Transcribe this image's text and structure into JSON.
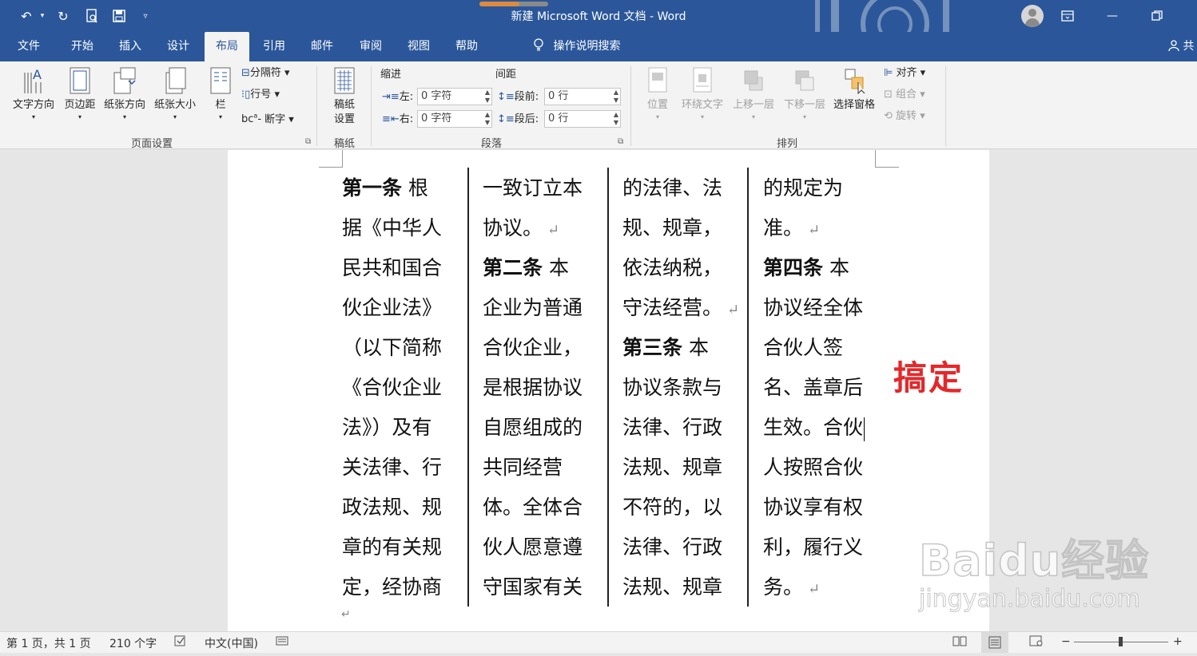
{
  "titlebar": {
    "doc_title": "新建 Microsoft Word 文档  -  Word",
    "undo_icon": "undo-icon",
    "redo_icon": "redo-icon"
  },
  "tabs": [
    "文件",
    "开始",
    "插入",
    "设计",
    "布局",
    "引用",
    "邮件",
    "审阅",
    "视图",
    "帮助"
  ],
  "active_tab": "布局",
  "tell_me": "操作说明搜索",
  "share": "共",
  "ribbon": {
    "page_setup": {
      "text_direction": "文字方向",
      "margins": "页边距",
      "orientation": "纸张方向",
      "size": "纸张大小",
      "columns": "栏",
      "breaks": "分隔符",
      "line_numbers": "行号",
      "hyphenation": "断字",
      "group_label": "页面设置"
    },
    "manuscript": {
      "button_line1": "稿纸",
      "button_line2": "设置",
      "group_label": "稿纸"
    },
    "paragraph": {
      "indent_header": "缩进",
      "spacing_header": "间距",
      "left_label": "左:",
      "left_value": "0 字符",
      "right_label": "右:",
      "right_value": "0 字符",
      "before_label": "段前:",
      "before_value": "0 行",
      "after_label": "段后:",
      "after_value": "0 行",
      "group_label": "段落"
    },
    "arrange": {
      "position": "位置",
      "wrap_text": "环绕文字",
      "bring_forward": "上移一层",
      "send_backward": "下移一层",
      "selection_pane": "选择窗格",
      "align": "对齐",
      "group": "组合",
      "rotate": "旋转",
      "group_label": "排列"
    }
  },
  "document": {
    "columns": [
      [
        "第一条 根",
        "据《中华人",
        "民共和国合",
        "伙企业法》",
        "（以下简称",
        "《合伙企业",
        "法》）及有",
        "关法律、行",
        "政法规、规",
        "章的有关规",
        "定，经协商"
      ],
      [
        "一致订立本",
        "协议。",
        "第二条 本",
        "企业为普通",
        "合伙企业，",
        "是根据协议",
        "自愿组成的",
        "共同经营",
        "体。全体合",
        "伙人愿意遵",
        "守国家有关"
      ],
      [
        "的法律、法",
        "规、规章，",
        "依法纳税，",
        "守法经营。",
        "第三条 本",
        "协议条款与",
        "法律、行政",
        "法规、规章",
        "不符的，以",
        "法律、行政",
        "法规、规章"
      ],
      [
        "的规定为",
        "准。",
        "第四条 本",
        "协议经全体",
        "合伙人签",
        "名、盖章后",
        "生效。合伙",
        "人按照合伙",
        "协议享有权",
        "利，履行义",
        "务。"
      ]
    ],
    "annotation": "搞定",
    "paragraph_mark": "↵"
  },
  "watermark": {
    "logo": "Baidu经验",
    "url": "jingyan.baidu.com"
  },
  "statusbar": {
    "page": "第 1 页，共 1 页",
    "words": "210 个字",
    "language": "中文(中国)",
    "zoom_minus": "−",
    "zoom_plus": "+"
  },
  "colors": {
    "brand": "#2b579a",
    "ribbon_bg": "#f3f3f3",
    "annotation": "#e4282a"
  }
}
